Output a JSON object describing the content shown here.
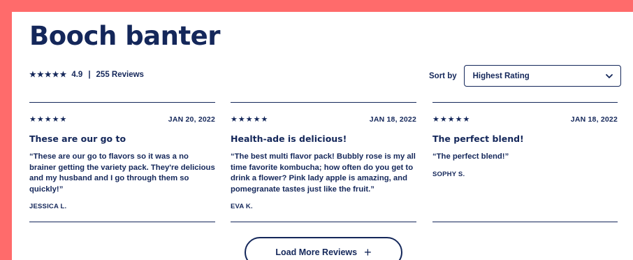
{
  "title": "Booch banter",
  "summary": {
    "stars": "★★★★★",
    "rating": "4.9",
    "separator": "|",
    "reviews_count": "255 Reviews"
  },
  "sort": {
    "label": "Sort by",
    "selected": "Highest Rating",
    "icon": "chevron-down-icon"
  },
  "reviews": [
    {
      "stars": "★★★★★",
      "date": "JAN 20, 2022",
      "title": "These are our go to",
      "body": "“These are our go to flavors so it was a no brainer getting the variety pack. They're delicious and my husband and I go through them so quickly!”",
      "author": "JESSICA L."
    },
    {
      "stars": "★★★★★",
      "date": "JAN 18, 2022",
      "title": "Health-ade is delicious!",
      "body": "“The best multi flavor pack! Bubbly rose is my all time favorite kombucha; how often do you get to drink a flower? Pink lady apple is amazing, and pomegranate tastes just like the fruit.”",
      "author": "EVA K."
    },
    {
      "stars": "★★★★★",
      "date": "JAN 18, 2022",
      "title": "The perfect blend!",
      "body": "“The perfect blend!”",
      "author": "SOPHY S."
    }
  ],
  "load_more": {
    "label": "Load More Reviews",
    "icon": "plus-icon"
  },
  "colors": {
    "frame": "#ff6b6b",
    "ink": "#14275a",
    "background": "#ffffff"
  }
}
